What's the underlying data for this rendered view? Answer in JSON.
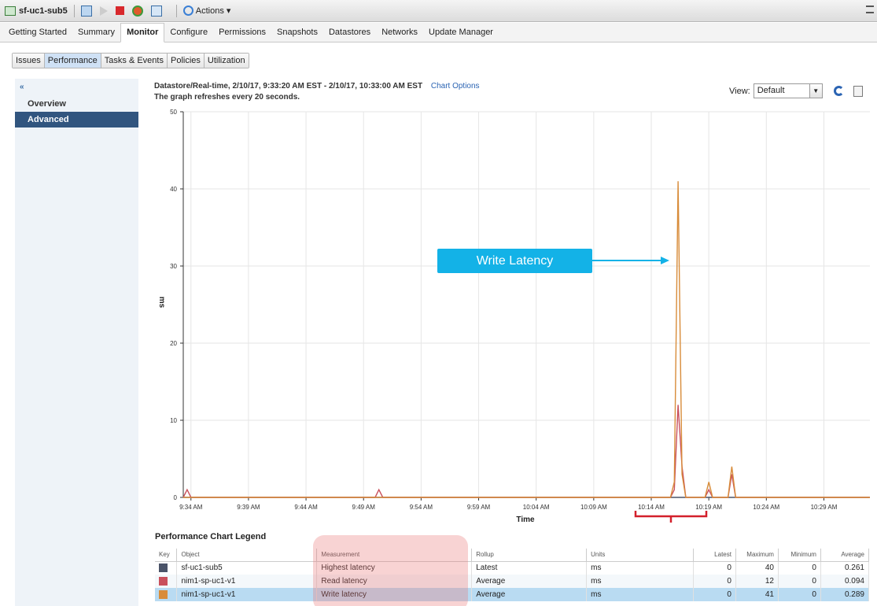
{
  "toolbar": {
    "vm_name": "sf-uc1-sub5",
    "actions_label": "Actions",
    "actions_caret": "▾"
  },
  "tabs": [
    {
      "label": "Getting Started"
    },
    {
      "label": "Summary"
    },
    {
      "label": "Monitor",
      "active": true
    },
    {
      "label": "Configure"
    },
    {
      "label": "Permissions"
    },
    {
      "label": "Snapshots"
    },
    {
      "label": "Datastores"
    },
    {
      "label": "Networks"
    },
    {
      "label": "Update Manager"
    }
  ],
  "subtabs": [
    {
      "label": "Issues"
    },
    {
      "label": "Performance",
      "active": true
    },
    {
      "label": "Tasks & Events"
    },
    {
      "label": "Policies"
    },
    {
      "label": "Utilization"
    }
  ],
  "leftnav": {
    "collapse_glyph": "«",
    "items": [
      {
        "label": "Overview"
      },
      {
        "label": "Advanced",
        "active": true
      }
    ]
  },
  "chart_header": {
    "line1": "Datastore/Real-time, 2/10/17, 9:33:20 AM EST - 2/10/17, 10:33:00 AM EST",
    "chart_options": "Chart Options",
    "line2": "The graph refreshes every 20 seconds."
  },
  "view": {
    "label": "View:",
    "value": "Default"
  },
  "annotation": {
    "callout": "Write Latency"
  },
  "chart_data": {
    "type": "line",
    "title": "",
    "xlabel": "Time",
    "ylabel": "ms",
    "ylim": [
      0,
      50
    ],
    "yticks": [
      0,
      10,
      20,
      30,
      40,
      50
    ],
    "xticks": [
      "9:34 AM",
      "9:39 AM",
      "9:44 AM",
      "9:49 AM",
      "9:54 AM",
      "9:59 AM",
      "10:04 AM",
      "10:09 AM",
      "10:14 AM",
      "10:19 AM",
      "10:24 AM",
      "10:29 AM"
    ],
    "xlim_minutes": [
      33.333,
      93.0
    ],
    "grid": true,
    "series": [
      {
        "name": "Highest latency",
        "color": "#4a5368",
        "points": [
          [
            33.333,
            0
          ],
          [
            33.5,
            0
          ],
          [
            93.0,
            0
          ]
        ]
      },
      {
        "name": "Read latency",
        "color": "#c9505c",
        "points": [
          [
            33.333,
            0
          ],
          [
            33.67,
            1
          ],
          [
            34.0,
            0
          ],
          [
            50.0,
            0
          ],
          [
            50.33,
            1
          ],
          [
            50.67,
            0
          ],
          [
            75.67,
            0
          ],
          [
            76.0,
            1
          ],
          [
            76.33,
            12
          ],
          [
            76.67,
            4
          ],
          [
            77.0,
            0
          ],
          [
            78.67,
            0
          ],
          [
            79.0,
            1
          ],
          [
            79.33,
            0
          ],
          [
            80.67,
            0
          ],
          [
            81.0,
            3
          ],
          [
            81.33,
            0
          ],
          [
            93.0,
            0
          ]
        ]
      },
      {
        "name": "Write latency",
        "color": "#d88c3a",
        "points": [
          [
            33.333,
            0
          ],
          [
            75.67,
            0
          ],
          [
            76.0,
            2
          ],
          [
            76.33,
            41
          ],
          [
            76.67,
            3
          ],
          [
            77.0,
            0
          ],
          [
            78.67,
            0
          ],
          [
            79.0,
            2
          ],
          [
            79.33,
            0
          ],
          [
            80.67,
            0
          ],
          [
            81.0,
            4
          ],
          [
            81.33,
            0
          ],
          [
            93.0,
            0
          ]
        ]
      }
    ]
  },
  "legend": {
    "title": "Performance Chart Legend",
    "columns": [
      "Key",
      "Object",
      "Measurement",
      "Rollup",
      "Units",
      "Latest",
      "Maximum",
      "Minimum",
      "Average"
    ],
    "rows": [
      {
        "color": "#4a5368",
        "object": "sf-uc1-sub5",
        "measurement": "Highest latency",
        "rollup": "Latest",
        "units": "ms",
        "latest": "0",
        "maximum": "40",
        "minimum": "0",
        "average": "0.261"
      },
      {
        "color": "#c9505c",
        "object": "nim1-sp-uc1-v1",
        "measurement": "Read latency",
        "rollup": "Average",
        "units": "ms",
        "latest": "0",
        "maximum": "12",
        "minimum": "0",
        "average": "0.094"
      },
      {
        "color": "#d88c3a",
        "object": "nim1-sp-uc1-v1",
        "measurement": "Write latency",
        "rollup": "Average",
        "units": "ms",
        "latest": "0",
        "maximum": "41",
        "minimum": "0",
        "average": "0.289",
        "selected": true
      }
    ]
  }
}
